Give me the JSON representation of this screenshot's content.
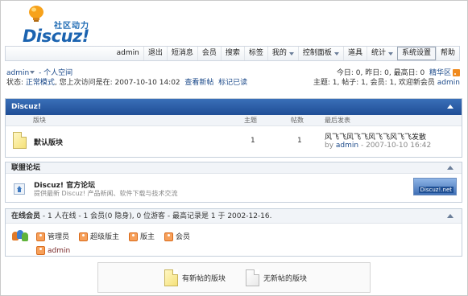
{
  "logo": {
    "cn": "社区动力",
    "word": "Discuz!"
  },
  "nav": {
    "items": [
      {
        "label": "admin",
        "dropdown": false
      },
      {
        "label": "退出",
        "dropdown": false
      },
      {
        "label": "短消息",
        "dropdown": false
      },
      {
        "label": "会员",
        "dropdown": false
      },
      {
        "label": "搜索",
        "dropdown": false
      },
      {
        "label": "标签",
        "dropdown": false
      },
      {
        "label": "我的",
        "dropdown": true
      },
      {
        "label": "控制面板",
        "dropdown": true
      },
      {
        "label": "道具",
        "dropdown": false
      },
      {
        "label": "统计",
        "dropdown": true
      },
      {
        "label": "系统设置",
        "dropdown": false,
        "selected": true
      },
      {
        "label": "帮助",
        "dropdown": false
      }
    ]
  },
  "user": {
    "name": "admin",
    "space_link": "- 个人空间",
    "status_prefix": "状态: ",
    "mode": "正常模式",
    "last_visit_text": ", 您上次访问是在: ",
    "last_visit": "2007-10-10 14:02",
    "view_new": "查看新帖",
    "mark_read": "标记已读"
  },
  "stats": {
    "today_label": "今日: ",
    "today": "0",
    "yesterday_label": ", 昨日: ",
    "yesterday": "0",
    "max_label": ", 最高日: ",
    "max": "0",
    "digest": "精华区",
    "threads_label": "主题: ",
    "threads": "1",
    "posts_label": ", 帖子: ",
    "posts": "1",
    "members_label": ", 会员: ",
    "members": "1",
    "welcome_label": ", 欢迎新会员 ",
    "newest": "admin"
  },
  "category": {
    "title": "Discuz!",
    "columns": {
      "forum": "版块",
      "threads": "主题",
      "posts": "帖数",
      "last": "最后发表"
    },
    "forums": [
      {
        "name": "默认版块",
        "threads": "1",
        "posts": "1",
        "last_title": "风飞飞风飞飞风飞飞风飞飞发散",
        "last_by": "by ",
        "last_author": "admin",
        "last_time": " - 2007-10-10 16:42"
      }
    ]
  },
  "union": {
    "title": "联盟论坛",
    "name": "Discuz! 官方论坛",
    "desc": "提供最新 Discuz! 产品新闻、软件下载与技术交流",
    "banner": "Discuz!.net"
  },
  "online": {
    "title": "在线会员",
    "summary": " - 1 人在线 - 1 会员(0 隐身), 0 位游客 - 最高记录是 1 于 2002-12-16.",
    "groups": [
      "管理员",
      "超级版主",
      "版主",
      "会员"
    ],
    "users": [
      "admin"
    ]
  },
  "legend": {
    "new": "有新帖的版块",
    "nonew": "无新帖的版块"
  }
}
